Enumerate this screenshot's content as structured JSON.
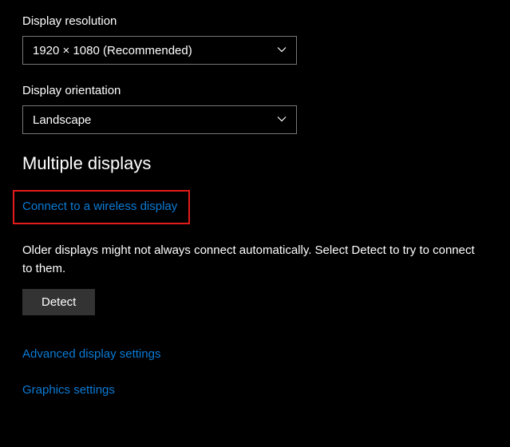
{
  "resolution": {
    "label": "Display resolution",
    "value": "1920 × 1080 (Recommended)"
  },
  "orientation": {
    "label": "Display orientation",
    "value": "Landscape"
  },
  "multipleDisplays": {
    "heading": "Multiple displays",
    "wirelessLink": "Connect to a wireless display",
    "infoText": "Older displays might not always connect automatically. Select Detect to try to connect to them.",
    "detectButton": "Detect"
  },
  "links": {
    "advanced": "Advanced display settings",
    "graphics": "Graphics settings"
  }
}
